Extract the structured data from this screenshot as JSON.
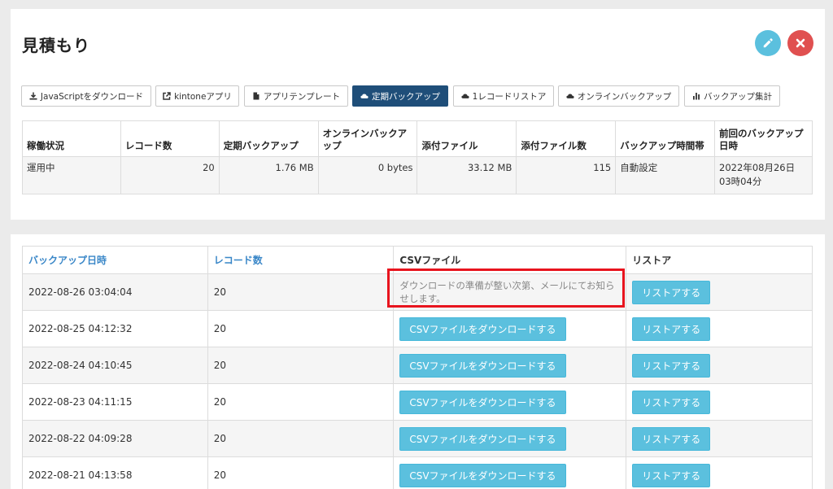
{
  "header": {
    "title": "見積もり"
  },
  "toolbar": {
    "buttons": [
      {
        "label": "JavaScriptをダウンロード",
        "icon": "download-icon",
        "active": false
      },
      {
        "label": "kintoneアプリ",
        "icon": "external-link-icon",
        "active": false
      },
      {
        "label": "アプリテンプレート",
        "icon": "file-icon",
        "active": false
      },
      {
        "label": "定期バックアップ",
        "icon": "cloud-icon",
        "active": true
      },
      {
        "label": "1レコードリストア",
        "icon": "cloud-icon",
        "active": false
      },
      {
        "label": "オンラインバックアップ",
        "icon": "cloud-icon",
        "active": false
      },
      {
        "label": "バックアップ集計",
        "icon": "bar-chart-icon",
        "active": false
      }
    ]
  },
  "status_table": {
    "headers": [
      "稼働状況",
      "レコード数",
      "定期バックアップ",
      "オンラインバックアップ",
      "添付ファイル",
      "添付ファイル数",
      "バックアップ時間帯",
      "前回のバックアップ日時"
    ],
    "row": [
      "運用中",
      "20",
      "1.76 MB",
      "0 bytes",
      "33.12 MB",
      "115",
      "自動設定",
      "2022年08月26日 03時04分"
    ]
  },
  "backup_table": {
    "headers": [
      "バックアップ日時",
      "レコード数",
      "CSVファイル",
      "リストア"
    ],
    "preparing_note": "ダウンロードの準備が整い次第、メールにてお知らせします。",
    "csv_button_label": "CSVファイルをダウンロードする",
    "restore_button_label": "リストアする",
    "rows": [
      {
        "datetime": "2022-08-26 03:04:04",
        "records": "20",
        "preparing": true
      },
      {
        "datetime": "2022-08-25 04:12:32",
        "records": "20",
        "preparing": false
      },
      {
        "datetime": "2022-08-24 04:10:45",
        "records": "20",
        "preparing": false
      },
      {
        "datetime": "2022-08-23 04:11:15",
        "records": "20",
        "preparing": false
      },
      {
        "datetime": "2022-08-22 04:09:28",
        "records": "20",
        "preparing": false
      },
      {
        "datetime": "2022-08-21 04:13:58",
        "records": "20",
        "preparing": false
      }
    ]
  },
  "colors": {
    "accent": "#5bc0de",
    "active_tab": "#1f4e79",
    "danger": "#e05050",
    "highlight": "#e8141e",
    "link": "#3a87c8"
  }
}
